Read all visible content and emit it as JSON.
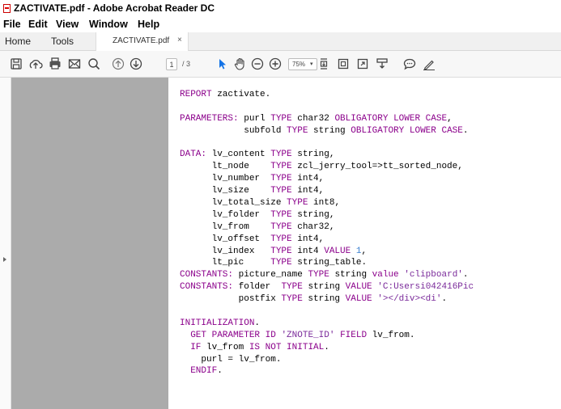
{
  "window": {
    "title": "ZACTIVATE.pdf - Adobe Acrobat Reader DC"
  },
  "menu": [
    "File",
    "Edit",
    "View",
    "Window",
    "Help"
  ],
  "tabs": {
    "home": "Home",
    "tools": "Tools",
    "document": "ZACTIVATE.pdf",
    "close": "×"
  },
  "toolbar": {
    "current_page": "1",
    "total_pages": "/ 3",
    "zoom": "75%",
    "icons": [
      "save-icon",
      "upload-icon",
      "print-icon",
      "email-icon",
      "search-icon",
      "page-up-icon",
      "page-down-icon",
      "select-arrow-icon",
      "hand-icon",
      "zoom-out-icon",
      "zoom-in-icon",
      "zoom-dropdown-icon",
      "fit-page-icon",
      "scrolling-mode-icon",
      "fullscreen-icon",
      "read-mode-icon",
      "comment-icon",
      "sign-icon"
    ]
  },
  "code_lines": [
    [
      [
        "kw",
        "REPORT"
      ],
      [
        "id",
        " zactivate."
      ]
    ],
    [],
    [
      [
        "kw",
        "PARAMETERS:"
      ],
      [
        "id",
        " purl "
      ],
      [
        "kw",
        "TYPE"
      ],
      [
        "id",
        " char32 "
      ],
      [
        "kw",
        "OBLIGATORY LOWER CASE"
      ],
      [
        "id",
        ","
      ]
    ],
    [
      [
        "id",
        "            subfold "
      ],
      [
        "kw",
        "TYPE"
      ],
      [
        "id",
        " string "
      ],
      [
        "kw",
        "OBLIGATORY LOWER CASE"
      ],
      [
        "id",
        "."
      ]
    ],
    [],
    [
      [
        "kw",
        "DATA:"
      ],
      [
        "id",
        " lv_content "
      ],
      [
        "kw",
        "TYPE"
      ],
      [
        "id",
        " string,"
      ]
    ],
    [
      [
        "id",
        "      lt_node    "
      ],
      [
        "kw",
        "TYPE"
      ],
      [
        "id",
        " zcl_jerry_tool=>tt_sorted_node,"
      ]
    ],
    [
      [
        "id",
        "      lv_number  "
      ],
      [
        "kw",
        "TYPE"
      ],
      [
        "id",
        " int4,"
      ]
    ],
    [
      [
        "id",
        "      lv_size    "
      ],
      [
        "kw",
        "TYPE"
      ],
      [
        "id",
        " int4,"
      ]
    ],
    [
      [
        "id",
        "      lv_total_size "
      ],
      [
        "kw",
        "TYPE"
      ],
      [
        "id",
        " int8,"
      ]
    ],
    [
      [
        "id",
        "      lv_folder  "
      ],
      [
        "kw",
        "TYPE"
      ],
      [
        "id",
        " string,"
      ]
    ],
    [
      [
        "id",
        "      lv_from    "
      ],
      [
        "kw",
        "TYPE"
      ],
      [
        "id",
        " char32,"
      ]
    ],
    [
      [
        "id",
        "      lv_offset  "
      ],
      [
        "kw",
        "TYPE"
      ],
      [
        "id",
        " int4,"
      ]
    ],
    [
      [
        "id",
        "      lv_index   "
      ],
      [
        "kw",
        "TYPE"
      ],
      [
        "id",
        " int4 "
      ],
      [
        "kw",
        "VALUE"
      ],
      [
        "id",
        " "
      ],
      [
        "num",
        "1"
      ],
      [
        "id",
        ","
      ]
    ],
    [
      [
        "id",
        "      lt_pic     "
      ],
      [
        "kw",
        "TYPE"
      ],
      [
        "id",
        " string_table."
      ]
    ],
    [
      [
        "kw",
        "CONSTANTS:"
      ],
      [
        "id",
        " picture_name "
      ],
      [
        "kw",
        "TYPE"
      ],
      [
        "id",
        " string "
      ],
      [
        "kw",
        "value"
      ],
      [
        "id",
        " "
      ],
      [
        "str",
        "'clipboard'"
      ],
      [
        "id",
        "."
      ]
    ],
    [
      [
        "kw",
        "CONSTANTS:"
      ],
      [
        "id",
        " folder  "
      ],
      [
        "kw",
        "TYPE"
      ],
      [
        "id",
        " string "
      ],
      [
        "kw",
        "VALUE"
      ],
      [
        "id",
        " "
      ],
      [
        "str",
        "'C:Usersi042416Pic"
      ]
    ],
    [
      [
        "id",
        "           postfix "
      ],
      [
        "kw",
        "TYPE"
      ],
      [
        "id",
        " string "
      ],
      [
        "kw",
        "VALUE"
      ],
      [
        "id",
        " "
      ],
      [
        "str",
        "'></div><di'"
      ],
      [
        "id",
        "."
      ]
    ],
    [],
    [
      [
        "kw",
        "INITIALIZATION"
      ],
      [
        "id",
        "."
      ]
    ],
    [
      [
        "id",
        "  "
      ],
      [
        "kw",
        "GET PARAMETER ID"
      ],
      [
        "id",
        " "
      ],
      [
        "str",
        "'ZNOTE_ID'"
      ],
      [
        "id",
        " "
      ],
      [
        "kw",
        "FIELD"
      ],
      [
        "id",
        " lv_from."
      ]
    ],
    [
      [
        "id",
        "  "
      ],
      [
        "kw",
        "IF"
      ],
      [
        "id",
        " lv_from "
      ],
      [
        "kw",
        "IS NOT INITIAL"
      ],
      [
        "id",
        "."
      ]
    ],
    [
      [
        "id",
        "    purl = lv_from."
      ]
    ],
    [
      [
        "id",
        "  "
      ],
      [
        "kw",
        "ENDIF"
      ],
      [
        "id",
        "."
      ]
    ]
  ]
}
